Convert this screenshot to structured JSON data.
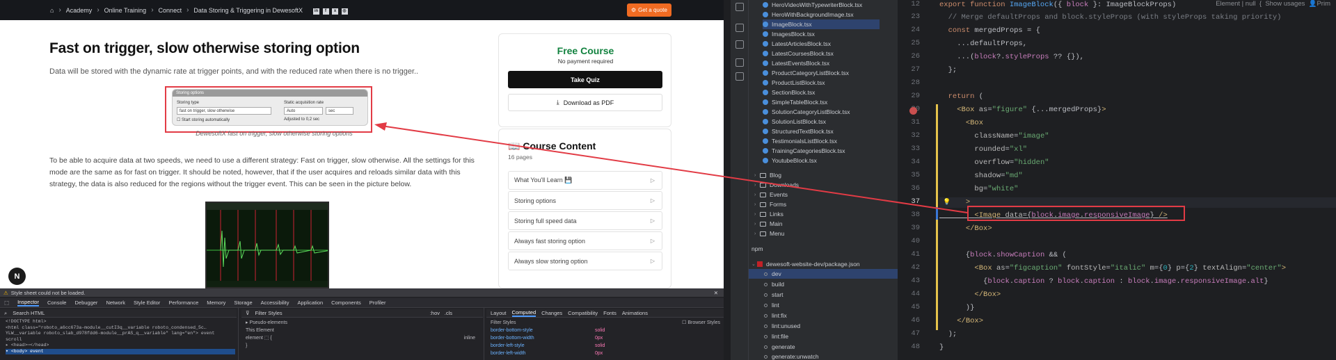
{
  "browser": {
    "breadcrumb": [
      "Academy",
      "Online Training",
      "Connect",
      "Data Storing & Triggering in DewesoftX"
    ],
    "social": [
      "in",
      "f",
      "x",
      "◎"
    ],
    "quote_label": "Get a quote",
    "nav_badge": "N"
  },
  "article": {
    "title": "Fast on trigger, slow otherwise storing option",
    "intro": "Data will be stored with the dynamic rate at trigger points, and with the reduced rate when there is no trigger..",
    "figure": {
      "header": "Storing options",
      "storing_type_label": "Storing type",
      "storing_type_value": "fast on trigger, slow otherwise",
      "static_label": "Static acquisition rate",
      "static_value": "Auto",
      "static_unit": "sec",
      "checkbox_label": "Start storing automatically",
      "adjusted": "Adjusted to 0,2 sec",
      "caption": "DewesoftX fast on trigger, slow otherwise storing options"
    },
    "paragraph": "To be able to acquire data at two speeds, we need to use a different strategy: Fast on trigger, slow otherwise. All the settings for this mode are the same as for fast on trigger. It should be noted, however, that if the user acquires and reloads similar data with this strategy, the data is also reduced for the regions without the trigger event. This can be seen in the picture below."
  },
  "sidebar": {
    "free_course": "Free Course",
    "no_payment": "No payment required",
    "take_quiz": "Take Quiz",
    "download_pdf": "Download as PDF",
    "course_content": "Course Content",
    "pages": "16 pages",
    "items": [
      "What You'll Learn 💾",
      "Storing options",
      "Storing full speed data",
      "Always fast storing option",
      "Always slow storing option"
    ]
  },
  "devtools": {
    "warning": "Style sheet could not be loaded.",
    "tabs": [
      "Inspector",
      "Console",
      "Debugger",
      "Network",
      "Style Editor",
      "Performance",
      "Memory",
      "Storage",
      "Accessibility",
      "Application",
      "Components",
      "Profiler"
    ],
    "search_html": "Search HTML",
    "filter_styles": "Filter Styles",
    "hov": ":hov",
    "cls": ".cls",
    "right_tabs": [
      "Layout",
      "Computed",
      "Changes",
      "Compatibility",
      "Fonts",
      "Animations"
    ],
    "filter_styles2": "Filter Styles",
    "browser_styles": "Browser Styles",
    "html_lines": [
      "<!DOCTYPE html>",
      "<html class=\"roboto_a6cc673a-module__cutI3q__variable roboto_condensed_5c…",
      "YLW__variable roboto_slab_d978fdd6-module__prAS_q__variable\" lang=\"en\"> event",
      "  scroll",
      "▸ <head>⋯</head>",
      "▾ <body> event"
    ],
    "pseudo": "Pseudo-elements",
    "this_element": "This Element",
    "element_rule": "element ⬚ {",
    "inline": "inline",
    "computed": [
      [
        "border-bottom-style",
        "solid"
      ],
      [
        "border-bottom-width",
        "0px"
      ],
      [
        "border-left-style",
        "solid"
      ],
      [
        "border-left-width",
        "0px"
      ]
    ]
  },
  "ide": {
    "files": [
      "HeroVideoWithTypewriterBlock.tsx",
      "HeroWithBackgroundImage.tsx",
      "ImageBlock.tsx",
      "ImagesBlock.tsx",
      "LatestArticlesBlock.tsx",
      "LatestCoursesBlock.tsx",
      "LatestEventsBlock.tsx",
      "ProductCategoryListBlock.tsx",
      "ProductListBlock.tsx",
      "SectionBlock.tsx",
      "SimpleTableBlock.tsx",
      "SolutionCategoryListBlock.tsx",
      "SolutionListBlock.tsx",
      "StructuredTextBlock.tsx",
      "TestimonialsListBlock.tsx",
      "TrainingCategoriesBlock.tsx",
      "YoutubeBlock.tsx"
    ],
    "folders": [
      "Blog",
      "Downloads",
      "Events",
      "Forms",
      "Links",
      "Main",
      "Menu"
    ],
    "npm_header": "npm",
    "package": "dewesoft-website-dev/package.json",
    "scripts": [
      "dev",
      "build",
      "start",
      "lint",
      "lint:fix",
      "lint:unused",
      "lint:file",
      "generate",
      "generate:unwatch"
    ],
    "hint_right": "Element | null",
    "show_usages": "Show usages",
    "author": "Prim",
    "line_numbers": [
      "12",
      "23",
      "24",
      "25",
      "26",
      "27",
      "28",
      "29",
      "30",
      "31",
      "32",
      "33",
      "34",
      "35",
      "36",
      "37",
      "38",
      "39",
      "40",
      "41",
      "42",
      "43",
      "44",
      "45",
      "46",
      "47",
      "48"
    ],
    "code": [
      "export function ImageBlock({ block }: ImageBlockProps) {",
      "  // Merge defaultProps and block.styleProps (with styleProps taking priority)",
      "  const mergedProps = {",
      "    ...defaultProps,",
      "    ...(block?.styleProps ?? {}),",
      "  };",
      "",
      "  return (",
      "    <Box as=\"figure\" {...mergedProps}>",
      "      <Box",
      "        className=\"image\"",
      "        rounded=\"xl\"",
      "        overflow=\"hidden\"",
      "        shadow=\"md\"",
      "        bg=\"white\"",
      "      >",
      "        <Image data={block.image.responsiveImage} />",
      "      </Box>",
      "",
      "      {block.showCaption && (",
      "        <Box as=\"figcaption\" fontStyle=\"italic\" m={0} p={2} textAlign=\"center\">",
      "          {block.caption ? block.caption : block.image.responsiveImage.alt}",
      "        </Box>",
      "      )}",
      "    </Box>",
      "  );",
      "}"
    ]
  }
}
